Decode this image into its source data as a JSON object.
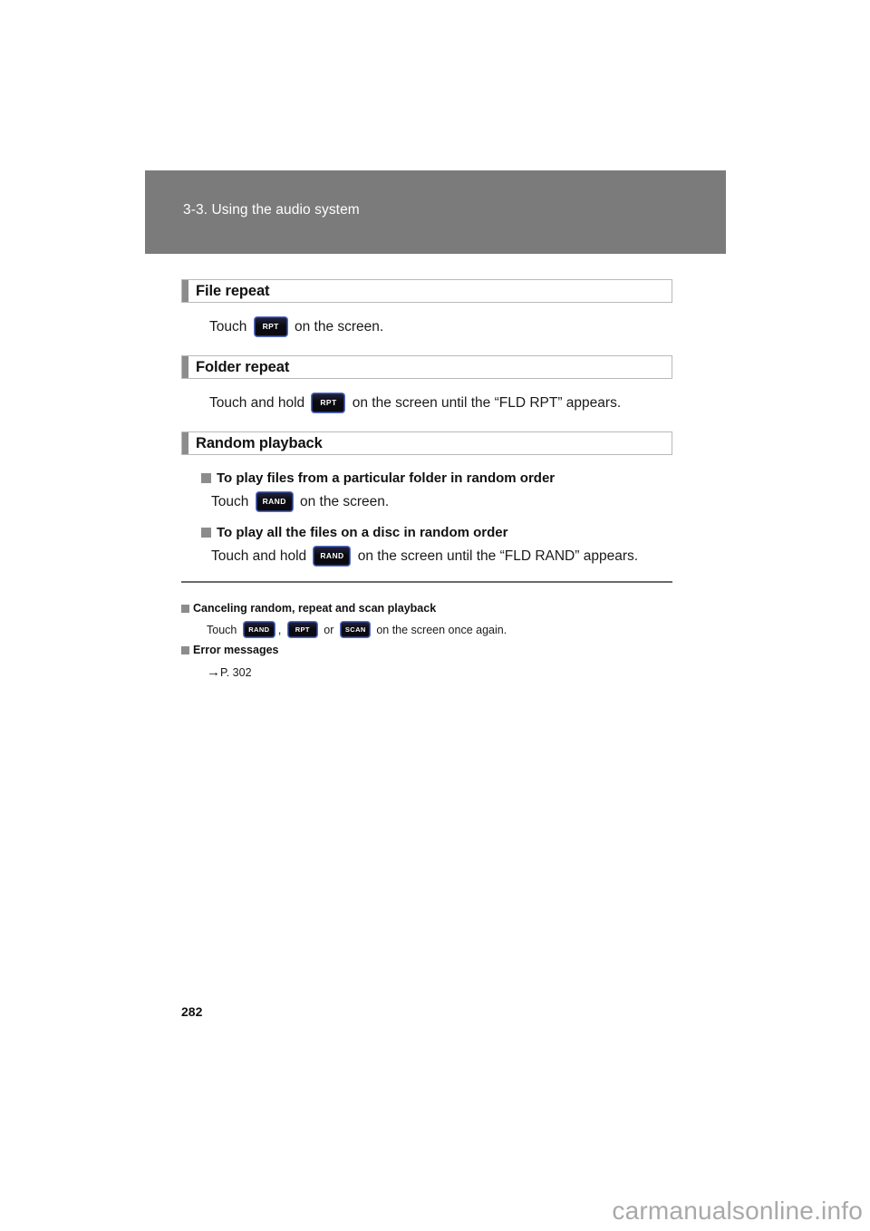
{
  "page": {
    "number": "282",
    "watermark": "carmanualsonline.info"
  },
  "chapter": {
    "title": "3-3. Using the audio system",
    "band_color": "#7b7b7b"
  },
  "sections": [
    {
      "heading": "File repeat",
      "line_prefix": "Touch ",
      "key": "RPT",
      "line_suffix": " on the screen."
    },
    {
      "heading": "Folder repeat",
      "line_prefix": "Touch and hold ",
      "key": "RPT",
      "line_suffix": " on the screen until the “FLD RPT” appears."
    }
  ],
  "random_section": {
    "heading": "Random playback",
    "items": [
      {
        "bullet_title": "To play files from a particular folder in random order",
        "line_prefix": "Touch ",
        "key": "RAND",
        "line_suffix": " on the screen."
      },
      {
        "bullet_title": "To play all the files on a disc in random order",
        "line_prefix": "Touch and hold ",
        "key": "RAND",
        "line_suffix": " on the screen until the “FLD RAND” appears."
      }
    ]
  },
  "notes": {
    "cancel": {
      "title": "Canceling random, repeat and scan playback",
      "line_prefix": "Touch ",
      "key1": "RAND",
      "separator1": ", ",
      "key2": "RPT",
      "separator2": " or ",
      "key3": "SCAN",
      "line_suffix": " on the screen once again."
    },
    "errors": {
      "title": "Error messages",
      "arrow": "→",
      "reference": "P. 302"
    }
  },
  "colors": {
    "band_gray": "#7b7b7b",
    "bullet_gray": "#8c8c8c",
    "key_dark": "#0d0d14",
    "key_border_blue": "#5a73c8",
    "watermark_gray": "#a9a9a9"
  }
}
